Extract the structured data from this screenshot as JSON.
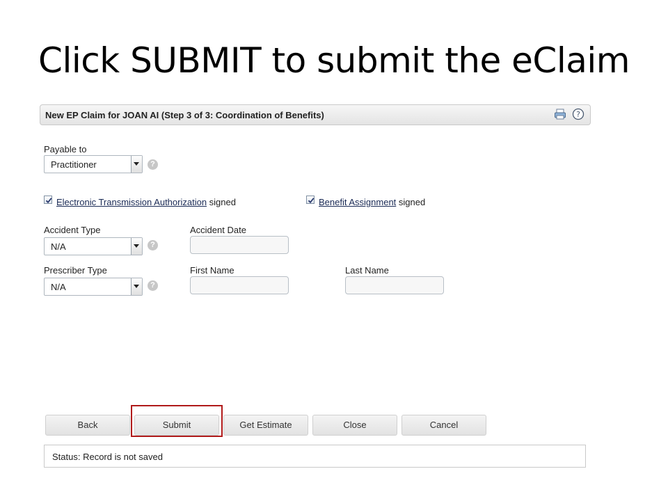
{
  "slide": {
    "title": "Click SUBMIT to submit the eClaim"
  },
  "panel": {
    "title": "New EP Claim for JOAN AI (Step 3 of 3: Coordination of Benefits)",
    "print_icon": "print-icon",
    "help_icon": "help-icon",
    "help_glyph": "?"
  },
  "form": {
    "payable_to": {
      "label": "Payable to",
      "value": "Practitioner"
    },
    "eta": {
      "checked": true,
      "link_text": "Electronic Transmission Authorization",
      "suffix": "signed"
    },
    "benefit": {
      "checked": true,
      "link_text": "Benefit Assignment",
      "suffix": "signed"
    },
    "accident_type": {
      "label": "Accident Type",
      "value": "N/A"
    },
    "accident_date": {
      "label": "Accident Date",
      "value": ""
    },
    "prescriber_type": {
      "label": "Prescriber Type",
      "value": "N/A"
    },
    "first_name": {
      "label": "First Name",
      "value": ""
    },
    "last_name": {
      "label": "Last Name",
      "value": ""
    },
    "help_glyph": "?"
  },
  "buttons": {
    "back": "Back",
    "submit": "Submit",
    "get_estimate": "Get Estimate",
    "close": "Close",
    "cancel": "Cancel"
  },
  "status": {
    "text": "Status: Record is not saved"
  },
  "colors": {
    "highlight": "#b01a1a",
    "link": "#1a2a55",
    "header_bg": "#e8e8e8"
  }
}
